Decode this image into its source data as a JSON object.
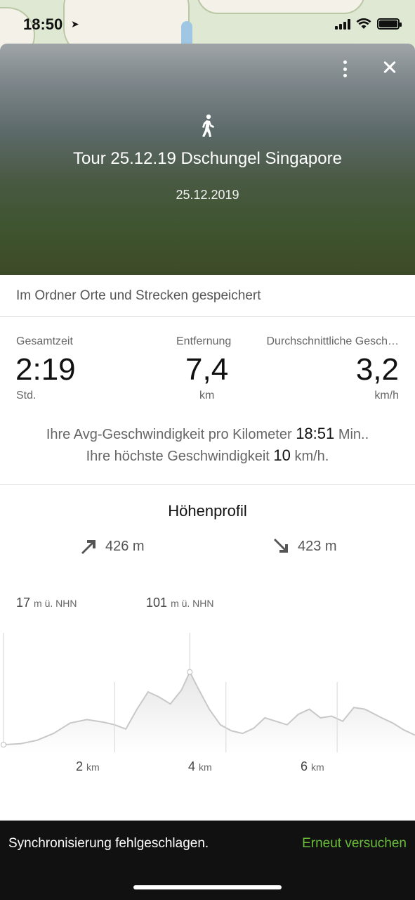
{
  "status_bar": {
    "time": "18:50"
  },
  "tour": {
    "title": "Tour 25.12.19 Dschungel Singapore",
    "date": "25.12.2019",
    "activity_icon": "walking-person-icon",
    "folder_notice": "Im Ordner Orte und Strecken gespeichert"
  },
  "stats": {
    "total_time": {
      "label": "Gesamtzeit",
      "value": "2:19",
      "unit": "Std."
    },
    "distance": {
      "label": "Entfernung",
      "value": "7,4",
      "unit": "km"
    },
    "avg_speed": {
      "label": "Durchschnittliche Gesch…",
      "value": "3,2",
      "unit": "km/h"
    }
  },
  "pace": {
    "line1_prefix": "Ihre Avg-Geschwindigkeit pro Kilometer",
    "line1_value": "18:51",
    "line1_suffix": "Min..",
    "line2_prefix": "Ihre höchste Geschwindigkeit",
    "line2_value": "10",
    "line2_suffix": "km/h."
  },
  "elevation": {
    "title": "Höhenprofil",
    "ascent": "426 m",
    "descent": "423 m",
    "start_label_value": "17",
    "start_label_unit": "m ü. NHN",
    "peak_label_value": "101",
    "peak_label_unit": "m ü. NHN",
    "distance_ticks": [
      {
        "value": "2",
        "unit": "km"
      },
      {
        "value": "4",
        "unit": "km"
      },
      {
        "value": "6",
        "unit": "km"
      }
    ],
    "profile_points": [
      [
        0,
        17
      ],
      [
        0.3,
        18
      ],
      [
        0.6,
        22
      ],
      [
        0.9,
        30
      ],
      [
        1.2,
        42
      ],
      [
        1.5,
        46
      ],
      [
        1.8,
        43
      ],
      [
        2.0,
        40
      ],
      [
        2.2,
        35
      ],
      [
        2.4,
        58
      ],
      [
        2.6,
        78
      ],
      [
        2.8,
        72
      ],
      [
        3.0,
        64
      ],
      [
        3.2,
        80
      ],
      [
        3.35,
        101
      ],
      [
        3.5,
        82
      ],
      [
        3.7,
        58
      ],
      [
        3.9,
        40
      ],
      [
        4.1,
        33
      ],
      [
        4.3,
        30
      ],
      [
        4.5,
        36
      ],
      [
        4.7,
        48
      ],
      [
        4.9,
        44
      ],
      [
        5.1,
        40
      ],
      [
        5.3,
        52
      ],
      [
        5.5,
        58
      ],
      [
        5.7,
        48
      ],
      [
        5.9,
        50
      ],
      [
        6.1,
        44
      ],
      [
        6.3,
        60
      ],
      [
        6.5,
        58
      ],
      [
        6.8,
        48
      ],
      [
        7.0,
        42
      ],
      [
        7.2,
        34
      ],
      [
        7.4,
        28
      ]
    ],
    "y_range": [
      0,
      130
    ]
  },
  "snackbar": {
    "message": "Synchronisierung fehlgeschlagen.",
    "action": "Erneut versuchen"
  },
  "colors": {
    "accent": "#6bbd3c",
    "snackbar_bg": "#111111"
  }
}
